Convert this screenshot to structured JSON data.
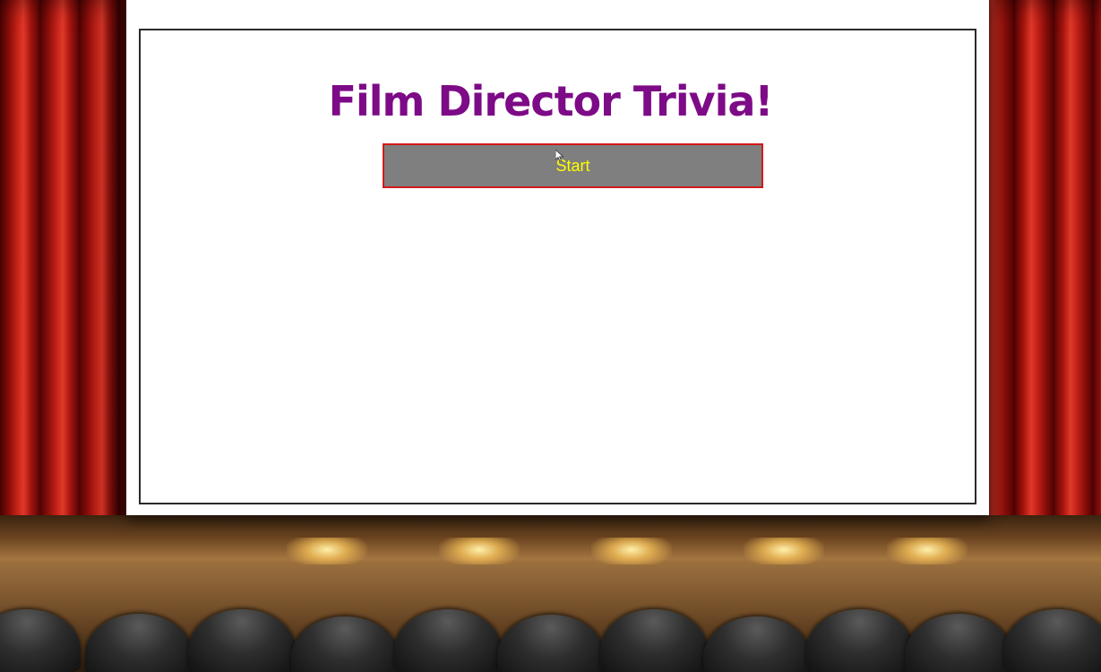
{
  "game": {
    "title": "Film Director Trivia!",
    "start_label": "Start"
  },
  "colors": {
    "title": "#7d0a86",
    "button_bg": "#7f7f7f",
    "button_border": "#d41a1a",
    "button_text": "#ffff00"
  },
  "icons": {
    "pointer": "mouse-pointer-icon"
  }
}
